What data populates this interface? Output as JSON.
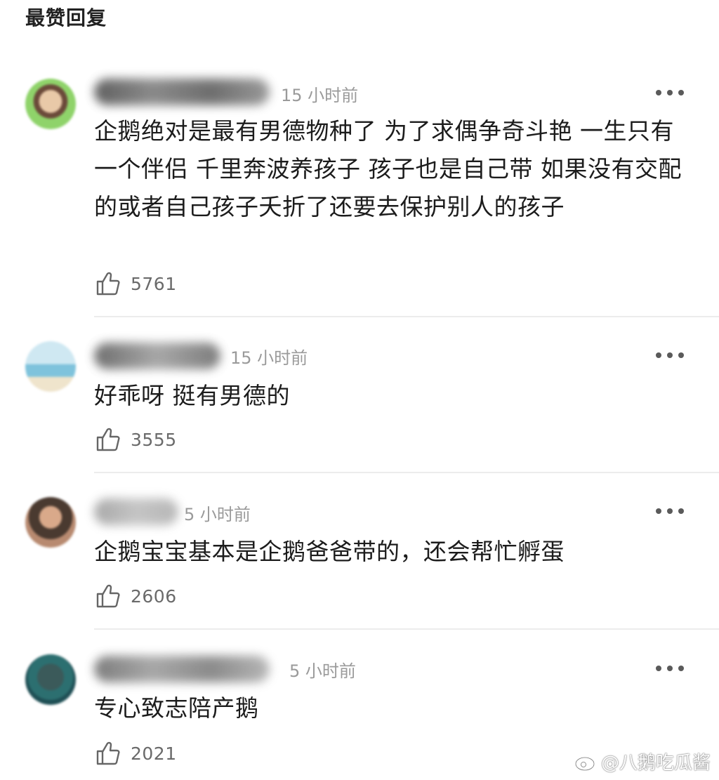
{
  "section_title": "最赞回复",
  "comments": [
    {
      "time": "15 小时前",
      "text": "企鹅绝对是最有男德物种了 为了求偶争奇斗艳 一生只有一个伴侣 千里奔波养孩子 孩子也是自己带 如果没有交配的或者自己孩子夭折了还要去保护别人的孩子",
      "likes": "5761"
    },
    {
      "time": "15 小时前",
      "text": "好乖呀 挺有男德的",
      "likes": "3555"
    },
    {
      "time": "5 小时前",
      "text": "企鹅宝宝基本是企鹅爸爸带的，还会帮忙孵蛋",
      "likes": "2606"
    },
    {
      "time": "5 小时前",
      "text": "专心致志陪产鹅",
      "likes": "2021"
    }
  ],
  "watermark": "@八鹅吃瓜酱",
  "icons": {
    "like": "thumbs-up-icon",
    "more": "more-dots-icon",
    "watermark": "weibo-logo-icon"
  },
  "colors": {
    "text": "#1c1c1c",
    "meta": "#9a9a9a",
    "divider": "#ececec"
  }
}
